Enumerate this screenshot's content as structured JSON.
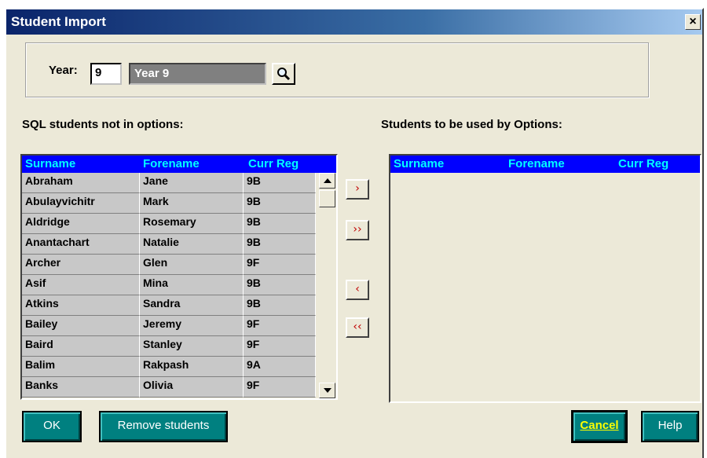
{
  "window": {
    "title": "Student Import",
    "close_label": "×"
  },
  "year": {
    "label": "Year:",
    "value": "9",
    "name": "Year 9"
  },
  "left_list": {
    "caption": "SQL students not in options:",
    "columns": [
      "Surname",
      "Forename",
      "Curr Reg"
    ],
    "rows": [
      [
        "Abraham",
        "Jane",
        "9B"
      ],
      [
        "Abulayvichitr",
        "Mark",
        "9B"
      ],
      [
        "Aldridge",
        "Rosemary",
        "9B"
      ],
      [
        "Anantachart",
        "Natalie",
        "9B"
      ],
      [
        "Archer",
        "Glen",
        "9F"
      ],
      [
        "Asif",
        "Mina",
        "9B"
      ],
      [
        "Atkins",
        "Sandra",
        "9B"
      ],
      [
        "Bailey",
        "Jeremy",
        "9F"
      ],
      [
        "Baird",
        "Stanley",
        "9F"
      ],
      [
        "Balim",
        "Rakpash",
        "9A"
      ],
      [
        "Banks",
        "Olivia",
        "9F"
      ]
    ]
  },
  "right_list": {
    "caption": "Students to be used by Options:",
    "columns": [
      "Surname",
      "Forename",
      "Curr Reg"
    ]
  },
  "move_buttons": {
    "add_one": "›",
    "add_all": "››",
    "remove_one": "‹",
    "remove_all": "‹‹"
  },
  "buttons": {
    "ok": "OK",
    "remove_students": "Remove students",
    "cancel": "Cancel",
    "help": "Help"
  },
  "icons": {
    "lookup": "magnifier-icon",
    "scroll_up": "arrow-up-icon",
    "scroll_down": "arrow-down-icon"
  }
}
